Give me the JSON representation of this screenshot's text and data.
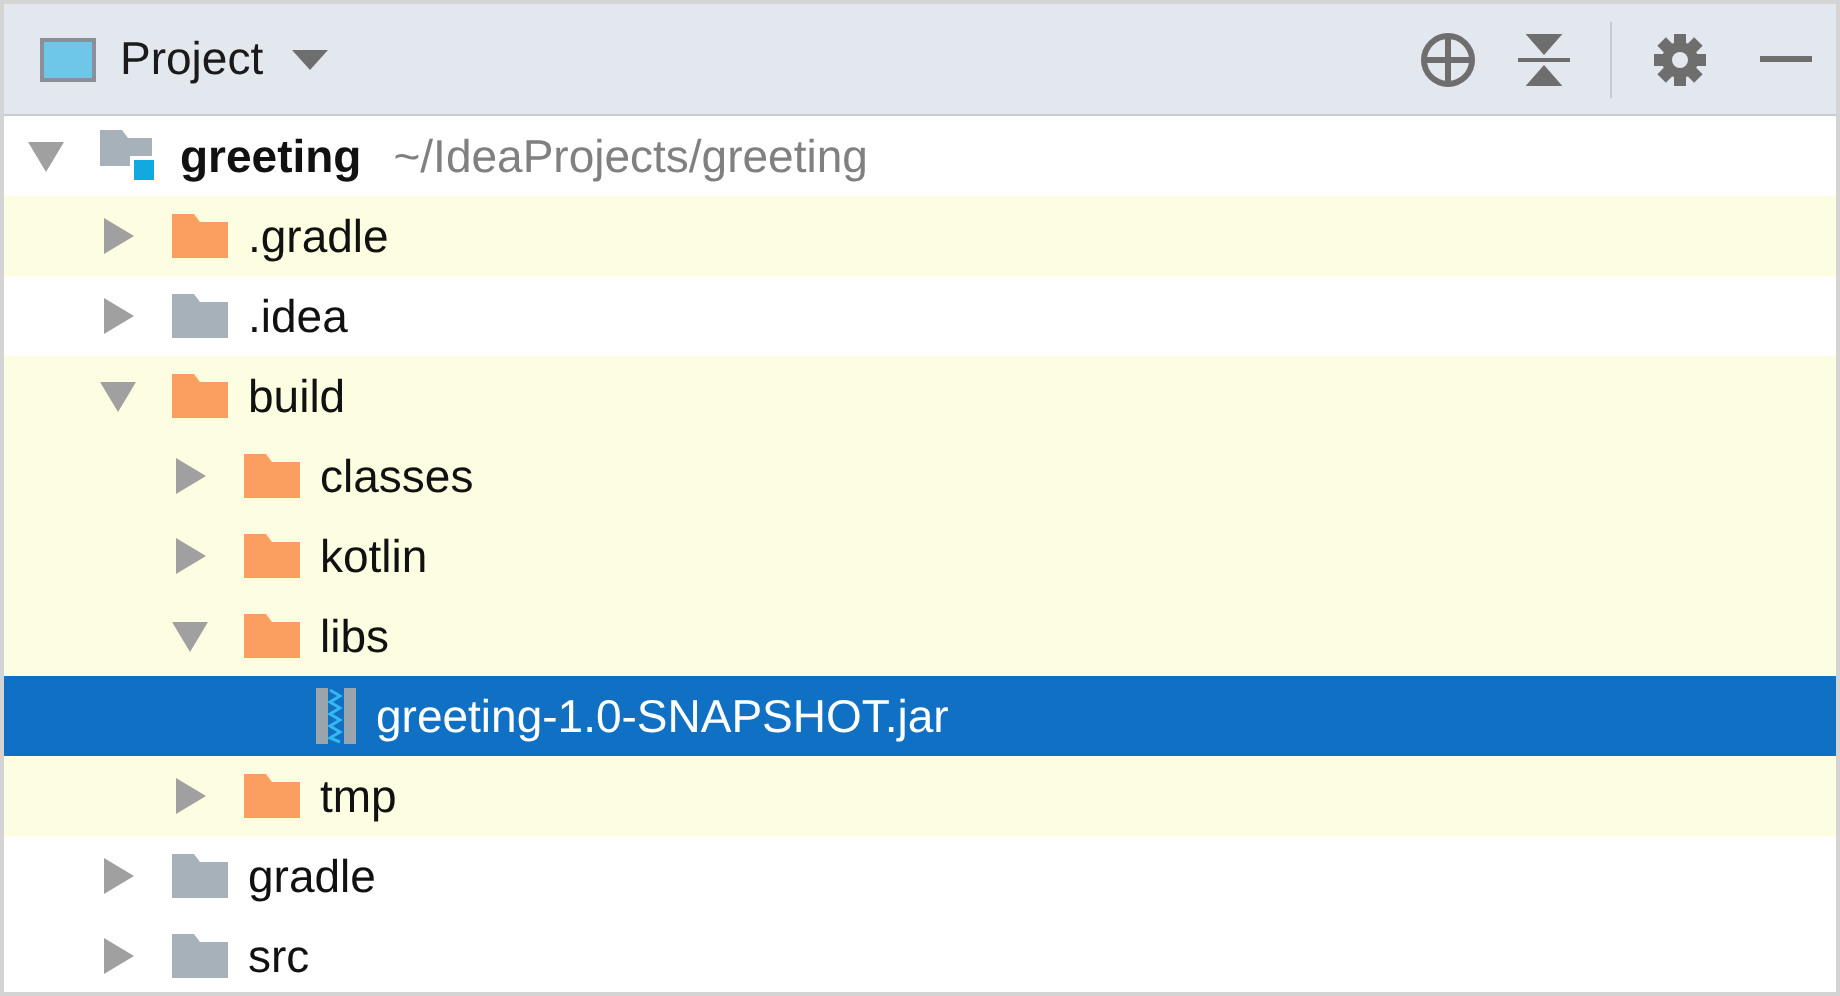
{
  "panel": {
    "title": "Project"
  },
  "tree": [
    {
      "name": "greeting",
      "path": "~/IdeaProjects/greeting",
      "kind": "module",
      "expanded": true,
      "excluded": false,
      "selected": false,
      "children": [
        {
          "name": ".gradle",
          "kind": "folder",
          "expanded": false,
          "excluded": true,
          "selected": false
        },
        {
          "name": ".idea",
          "kind": "folder",
          "expanded": false,
          "excluded": false,
          "selected": false
        },
        {
          "name": "build",
          "kind": "folder",
          "expanded": true,
          "excluded": true,
          "selected": false,
          "children": [
            {
              "name": "classes",
              "kind": "folder",
              "expanded": false,
              "excluded": true,
              "selected": false
            },
            {
              "name": "kotlin",
              "kind": "folder",
              "expanded": false,
              "excluded": true,
              "selected": false
            },
            {
              "name": "libs",
              "kind": "folder",
              "expanded": true,
              "excluded": true,
              "selected": false,
              "children": [
                {
                  "name": "greeting-1.0-SNAPSHOT.jar",
                  "kind": "jar",
                  "selected": true
                }
              ]
            },
            {
              "name": "tmp",
              "kind": "folder",
              "expanded": false,
              "excluded": true,
              "selected": false
            }
          ]
        },
        {
          "name": "gradle",
          "kind": "folder",
          "expanded": false,
          "excluded": false,
          "selected": false
        },
        {
          "name": "src",
          "kind": "folder",
          "expanded": false,
          "excluded": false,
          "selected": false
        }
      ]
    }
  ]
}
